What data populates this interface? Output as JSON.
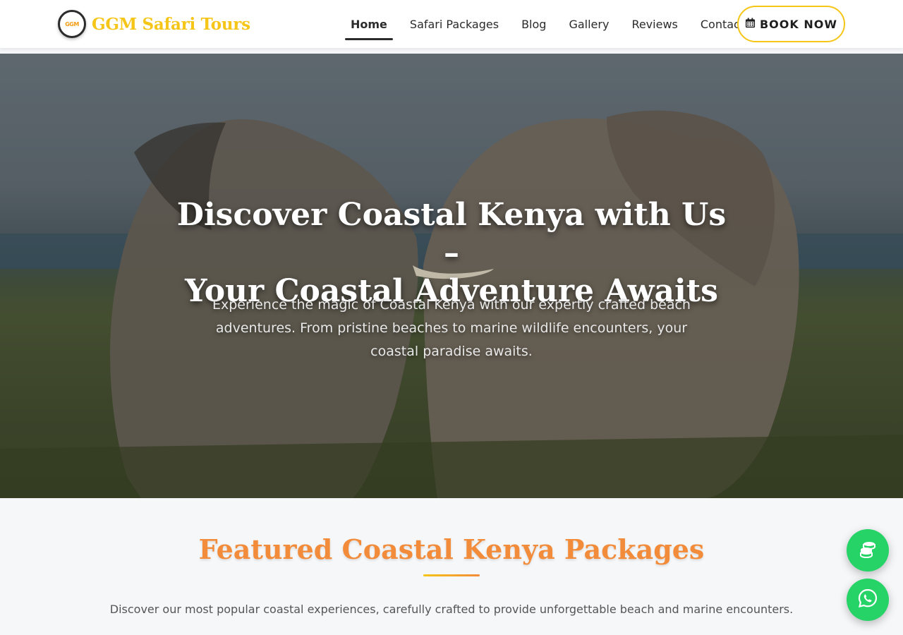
{
  "brand": {
    "logo_text": "GGM",
    "name": "GGM Safari Tours"
  },
  "nav": {
    "items": [
      {
        "label": "Home",
        "active": true
      },
      {
        "label": "Safari Packages",
        "active": false
      },
      {
        "label": "Blog",
        "active": false
      },
      {
        "label": "Gallery",
        "active": false
      },
      {
        "label": "Reviews",
        "active": false
      },
      {
        "label": "Contact",
        "active": false
      }
    ],
    "book_label": "BOOK NOW",
    "book_icon": "calendar-icon"
  },
  "hero": {
    "title_line1": "Discover Coastal Kenya with Us –",
    "title_line2": "Your Coastal Adventure Awaits",
    "subtitle_line1": "Experience the magic of Coastal Kenya with our expertly crafted beach",
    "subtitle_line2": "adventures. From pristine beaches to marine wildlife encounters, your",
    "subtitle_line3": "coastal paradise awaits."
  },
  "featured": {
    "title": "Featured Coastal Kenya Packages",
    "description": "Discover our most popular coastal experiences, carefully crafted to provide unforgettable beach and marine encounters."
  },
  "floating": {
    "coins_icon": "coins-icon",
    "whatsapp_icon": "whatsapp-icon"
  },
  "colors": {
    "brand_yellow": "#f5c518",
    "accent_orange": "#f28c3a",
    "whatsapp_green": "#25d366"
  }
}
